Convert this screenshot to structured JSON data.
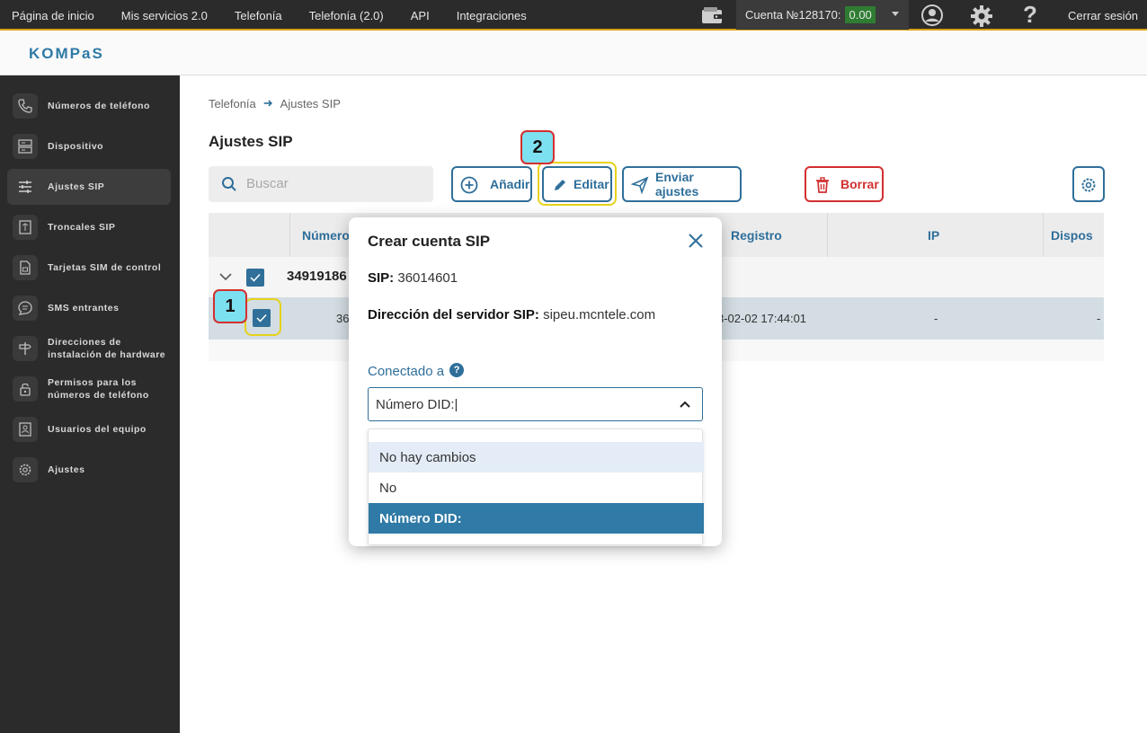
{
  "topnav": {
    "items": [
      "Página de inicio",
      "Mis servicios 2.0",
      "Telefonía",
      "Telefonía (2.0)",
      "API",
      "Integraciones"
    ],
    "account_label": "Cuenta №128170:",
    "balance": "0.00",
    "help_glyph": "?",
    "logout": "Cerrar sesión"
  },
  "logo": "KOMPaS",
  "sidebar": {
    "items": [
      {
        "label": "Números de teléfono",
        "icon": "phone-icon"
      },
      {
        "label": "Dispositivo",
        "icon": "server-icon"
      },
      {
        "label": "Ajustes SIP",
        "icon": "sliders-icon"
      },
      {
        "label": "Troncales SIP",
        "icon": "trunk-icon"
      },
      {
        "label": "Tarjetas SIM de control",
        "icon": "sim-card-icon"
      },
      {
        "label": "SMS entrantes",
        "icon": "message-icon"
      },
      {
        "label": "Direcciones de instalación de hardware",
        "icon": "signpost-icon"
      },
      {
        "label": "Permisos para los números de teléfono",
        "icon": "lock-icon"
      },
      {
        "label": "Usuarios del equipo",
        "icon": "user-card-icon"
      },
      {
        "label": "Ajustes",
        "icon": "gear-icon"
      }
    ],
    "active_index": 2
  },
  "breadcrumb": {
    "root": "Telefonía",
    "current": "Ajustes SIP"
  },
  "page_title": "Ajustes SIP",
  "search": {
    "placeholder": "Buscar"
  },
  "toolbar": {
    "add": "Añadir",
    "edit": "Editar",
    "send": "Enviar ajustes",
    "delete": "Borrar"
  },
  "table": {
    "headers": {
      "number": "Número",
      "registro": "Registro",
      "ip": "IP",
      "dispos": "Dispos"
    },
    "group": {
      "label": "34919186"
    },
    "row": {
      "number": "36",
      "registro": "3-02-02 17:44:01",
      "ip": "-",
      "dispos": "-"
    }
  },
  "annotations": {
    "step1": "1",
    "step2": "2"
  },
  "modal": {
    "title": "Crear cuenta SIP",
    "sip_label": "SIP:",
    "sip_value": "36014601",
    "server_label": "Dirección del servidor SIP:",
    "server_value": "sipeu.mcntele.com",
    "connected_label": "Conectado a",
    "help_glyph": "?",
    "select_value": "Número DID:|",
    "options": [
      "No hay cambios",
      "No",
      "Número DID:"
    ],
    "hover_index": 0,
    "selected_index": 2
  },
  "colors": {
    "accent": "#2f6f9a",
    "danger": "#d32f2f",
    "highlight": "#e6d21a",
    "badge": "#7de0f0"
  }
}
